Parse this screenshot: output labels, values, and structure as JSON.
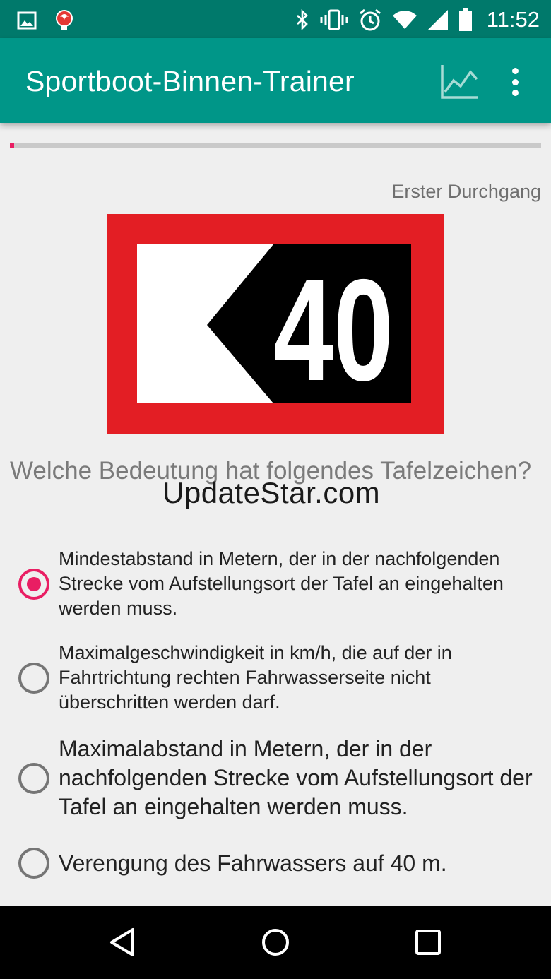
{
  "status_bar": {
    "time": "11:52",
    "icons": [
      "image-icon",
      "app-notification-icon",
      "bluetooth-icon",
      "vibrate-icon",
      "alarm-icon",
      "wifi-icon",
      "signal-icon",
      "battery-icon"
    ]
  },
  "app_bar": {
    "title": "Sportboot-Binnen-Trainer",
    "actions": [
      "chart-icon",
      "overflow-menu-icon"
    ]
  },
  "progress": {
    "value": 0.007
  },
  "round_label": "Erster Durchgang",
  "sign": {
    "number": "40",
    "colors": {
      "border": "#e31e24",
      "field": "#ffffff",
      "arrow": "#000000"
    }
  },
  "question": "Welche Bedeutung hat folgendes Tafelzeichen?",
  "watermark": "UpdateStar.com",
  "options": [
    {
      "text": "Mindestabstand in Metern, der in der nachfolgenden Strecke vom Aufstellungsort der Tafel an eingehalten werden muss.",
      "selected": true
    },
    {
      "text": "Maximalgeschwindigkeit in km/h, die auf der in Fahrtrichtung rechten Fahrwasserseite nicht überschritten werden darf.",
      "selected": false
    },
    {
      "text": "Maximalabstand in Metern, der in der nachfolgenden Strecke vom Aufstellungsort der Tafel an eingehalten werden muss.",
      "selected": false
    },
    {
      "text": "Verengung des Fahrwassers auf 40 m.",
      "selected": false
    }
  ],
  "colors": {
    "primary": "#009688",
    "primary_dark": "#00796b",
    "accent": "#e91e63"
  },
  "nav_bar": [
    "back-icon",
    "home-icon",
    "recents-icon"
  ]
}
